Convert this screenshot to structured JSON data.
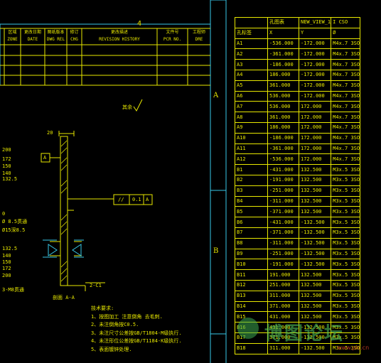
{
  "drawing": {
    "zone_top": "4",
    "zone_a": "A",
    "zone_b": "B",
    "revision_headers": [
      {
        "cn": "区域",
        "en": "ZONE"
      },
      {
        "cn": "更改日期",
        "en": "DATE"
      },
      {
        "cn": "图纸版本",
        "en": "DWG REL"
      },
      {
        "cn": "修订",
        "en": "CHG"
      },
      {
        "cn": "更改描述",
        "en": "REVISION HISTORY"
      },
      {
        "cn": "文件号",
        "en": "PCR NO."
      },
      {
        "cn": "工程师",
        "en": "DRE"
      }
    ],
    "surface_finish": "其余",
    "dim_20": "20",
    "datum_a": "A",
    "left_dims_top": [
      "200",
      "172",
      "150",
      "140",
      "132.5"
    ],
    "left_dim_zero": "0",
    "hole_spec_1": "Ø 8.5贯通",
    "hole_spec_2": "Ø15深8.5",
    "left_dims_bottom": [
      "132.5",
      "140",
      "150",
      "172",
      "200"
    ],
    "hole_spec_3": "3-M8贯通",
    "tolerance_symbol": "//",
    "tolerance_value": "0.1",
    "tolerance_datum": "A",
    "chamfer": "2-C1",
    "section_label": "剖面  A-A",
    "notes_title": "技术要求:",
    "notes": [
      "1、按图加工  注意倒角  去毛刺.",
      "2、未注倒角按C0.5.",
      "3、未注尺寸公差按GB/T1804-M级执行.",
      "4、未注形位公差按GB/T1184-K级执行.",
      "5、表面镀锌处理."
    ]
  },
  "hole_table": {
    "header": [
      "孔图表",
      "NEW_VIEW_1",
      "I  CSO"
    ],
    "subheader": [
      "孔标签",
      "X",
      "Y",
      "Ø"
    ],
    "rows": [
      [
        "A1",
        "-536.000",
        "-172.000",
        "M4x.7 3SO"
      ],
      [
        "A2",
        "-361.000",
        "-172.000",
        "M4x.7 3SO"
      ],
      [
        "A3",
        "-186.000",
        "-172.000",
        "M4x.7 3SO"
      ],
      [
        "A4",
        "186.000",
        "-172.000",
        "M4x.7 3SO"
      ],
      [
        "A5",
        "361.000",
        "-172.000",
        "M4x.7 3SO"
      ],
      [
        "A6",
        "536.000",
        "-172.000",
        "M4x.7 3SO"
      ],
      [
        "A7",
        "536.000",
        "172.000",
        "M4x.7 3SO"
      ],
      [
        "A8",
        "361.000",
        "172.000",
        "M4x.7 3SO"
      ],
      [
        "A9",
        "186.000",
        "172.000",
        "M4x.7 3SO"
      ],
      [
        "A10",
        "-186.000",
        "172.000",
        "M4x.7 3SO"
      ],
      [
        "A11",
        "-361.000",
        "172.000",
        "M4x.7 3SO"
      ],
      [
        "A12",
        "-536.000",
        "172.000",
        "M4x.7 3SO"
      ],
      [
        "B1",
        "-431.000",
        "132.500",
        "M3x.5 3SO"
      ],
      [
        "B2",
        "-191.000",
        "132.500",
        "M3x.5 3SO"
      ],
      [
        "B3",
        "-251.000",
        "132.500",
        "M3x.5 3SO"
      ],
      [
        "B4",
        "-311.000",
        "132.500",
        "M3x.5 3SO"
      ],
      [
        "B5",
        "-371.000",
        "132.500",
        "M3x.5 3SO"
      ],
      [
        "B6",
        "-431.000",
        "-132.500",
        "M3x.5 3SO"
      ],
      [
        "B7",
        "-371.000",
        "-132.500",
        "M3x.5 3SO"
      ],
      [
        "B8",
        "-311.000",
        "-132.500",
        "M3x.5 3SO"
      ],
      [
        "B9",
        "-251.000",
        "-132.500",
        "M3x.5 3SO"
      ],
      [
        "B10",
        "-191.000",
        "-132.500",
        "M3x.5 3SO"
      ],
      [
        "B11",
        "191.000",
        "132.500",
        "M3x.5 3SO"
      ],
      [
        "B12",
        "251.000",
        "132.500",
        "M3x.5 3SO"
      ],
      [
        "B13",
        "311.000",
        "132.500",
        "M3x.5 3SO"
      ],
      [
        "B14",
        "371.000",
        "132.500",
        "M3x.5 3SO"
      ],
      [
        "B15",
        "431.000",
        "132.500",
        "M3x.5 3SO"
      ],
      [
        "B16",
        "431.000",
        "-132.500",
        "M3x.5 3SO"
      ],
      [
        "B17",
        "371.000",
        "-132.500",
        "M3x.5 3SO"
      ],
      [
        "B18",
        "311.000",
        "-132.500",
        "M3x.5 3SO"
      ]
    ]
  },
  "watermark": {
    "text": "博图论坛",
    "url": "www.plc.cn"
  }
}
